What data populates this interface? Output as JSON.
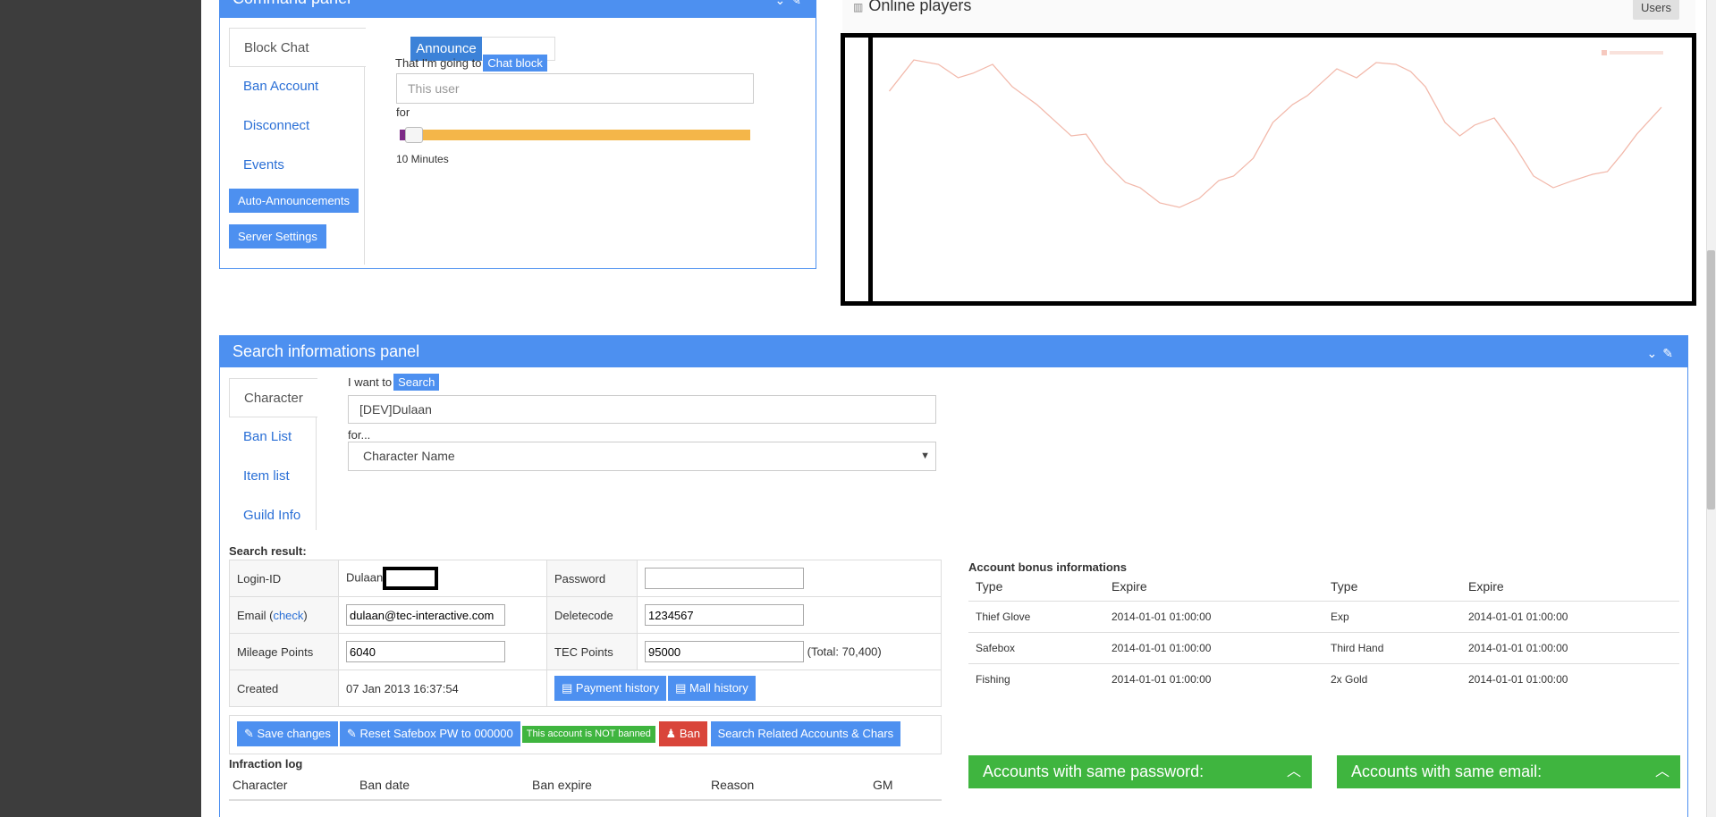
{
  "command_panel": {
    "title": "Command panel",
    "tabs": [
      "Block Chat",
      "Ban Account",
      "Disconnect",
      "Events"
    ],
    "buttons": [
      "Auto-Announcements",
      "Server Settings"
    ],
    "announce_label": "Announce",
    "going_to_text": "That I'm going to",
    "chat_block_label": "Chat block",
    "user_placeholder": "This user",
    "for_label": "for",
    "duration_text": "10 Minutes",
    "slider_fraction": 0.05
  },
  "online_players": {
    "title": "Online players",
    "users_button": "Users"
  },
  "search_panel": {
    "title": "Search informations panel",
    "tabs": [
      "Character",
      "Ban List",
      "Item list",
      "Guild Info"
    ],
    "want_to_text": "I want to",
    "search_pill": "Search",
    "search_value": "[DEV]Dulaan",
    "for_text": "for...",
    "search_type": "Character Name",
    "result_title": "Search result:",
    "login_label": "Login-ID",
    "login_value": "Dulaan",
    "password_label": "Password",
    "password_value": "",
    "email_label": "Email (",
    "email_check": "check",
    "email_close": ")",
    "email_value": "dulaan@tec-interactive.com",
    "deletecode_label": "Deletecode",
    "deletecode_value": "1234567",
    "mileage_label": "Mileage Points",
    "mileage_value": "6040",
    "tec_label": "TEC Points",
    "tec_value": "95000",
    "tec_total": "(Total: 70,400)",
    "created_label": "Created",
    "created_value": "07 Jan 2013 16:37:54",
    "payment_history": "Payment history",
    "mall_history": "Mall history",
    "save_changes": "Save changes",
    "reset_safebox": "Reset Safebox PW to 000000",
    "ban_status": "This account is NOT banned",
    "ban_button": "Ban",
    "search_related": "Search Related Accounts & Chars",
    "infraction_title": "Infraction log",
    "infraction_headers": [
      "Character",
      "Ban date",
      "Ban expire",
      "Reason",
      "GM"
    ],
    "bonus_title": "Account bonus informations",
    "bonus_headers": [
      "Type",
      "Expire",
      "Type",
      "Expire"
    ],
    "bonus_rows": [
      [
        "Thief Glove",
        "2014-01-01 01:00:00",
        "Exp",
        "2014-01-01 01:00:00"
      ],
      [
        "Safebox",
        "2014-01-01 01:00:00",
        "Third Hand",
        "2014-01-01 01:00:00"
      ],
      [
        "Fishing",
        "2014-01-01 01:00:00",
        "2x Gold",
        "2014-01-01 01:00:00"
      ]
    ],
    "same_password": "Accounts with same password:",
    "same_email": "Accounts with same email:"
  },
  "colors": {
    "accent": "#4d90f0",
    "success": "#3fb53f",
    "danger": "#d9453a",
    "sidebar": "#3d3d3d"
  }
}
